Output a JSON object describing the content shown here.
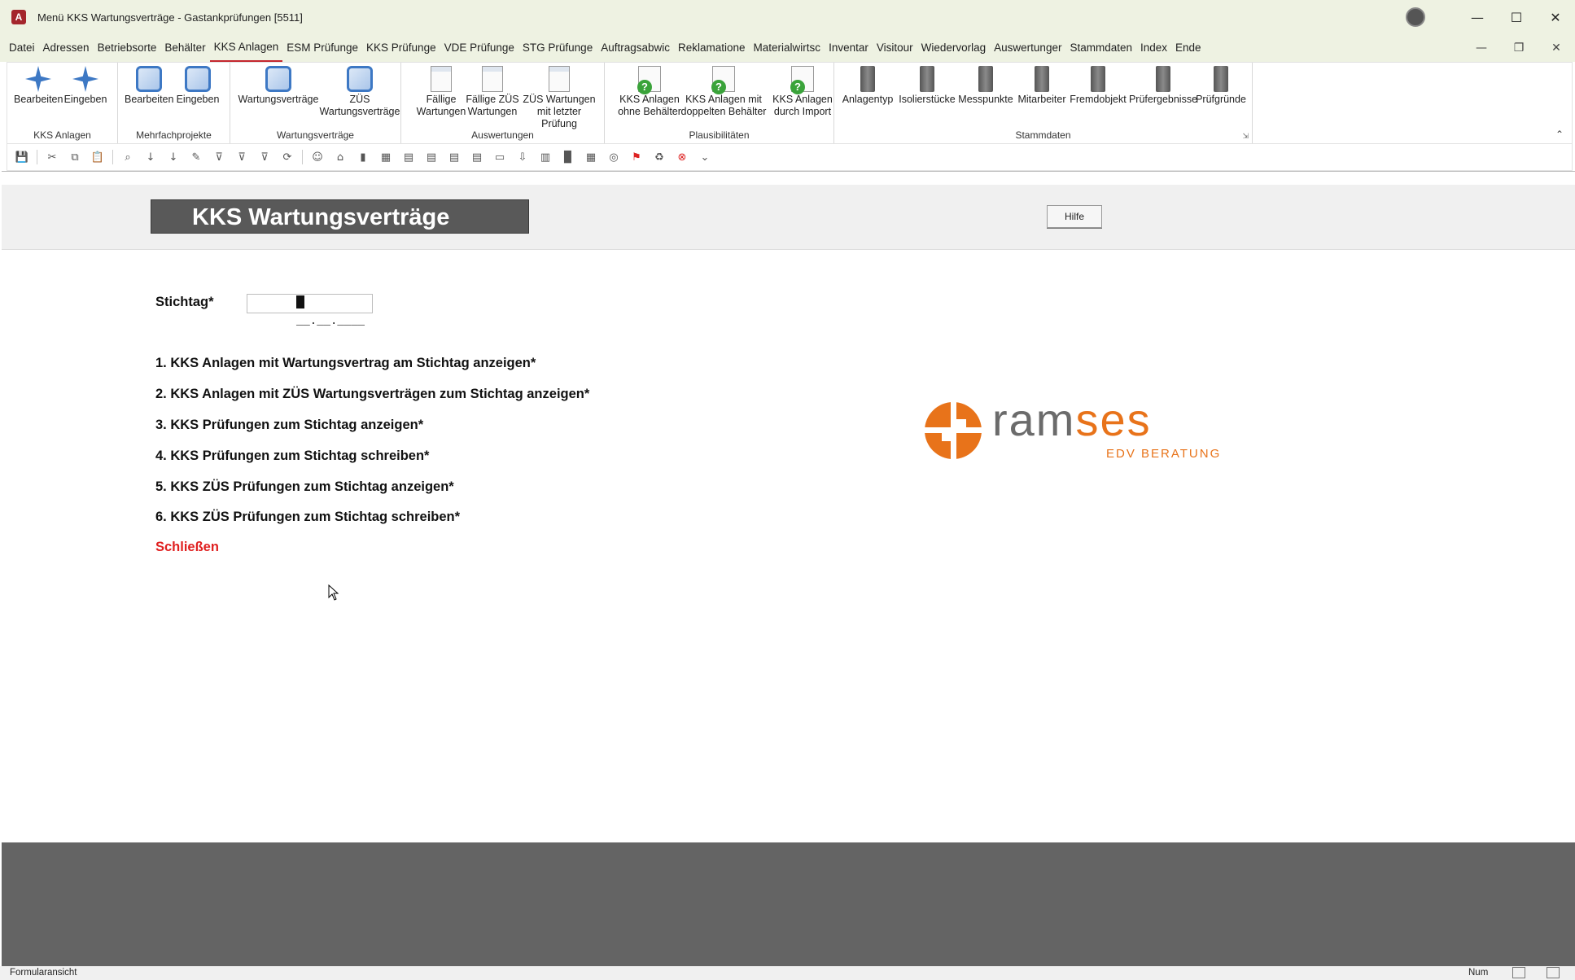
{
  "window": {
    "app_icon": "A",
    "title": "Menü KKS Wartungsverträge  -  Gastankprüfungen [5511]",
    "controls": {
      "minimize": "—",
      "maximize": "☐",
      "close": "✕"
    },
    "mdi_controls": {
      "minimize": "—",
      "restore": "❐",
      "close": "✕"
    }
  },
  "menu": {
    "items": [
      "Datei",
      "Adressen",
      "Betriebsorte",
      "Behälter",
      "KKS Anlagen",
      "ESM Prüfunge",
      "KKS Prüfunge",
      "VDE Prüfunge",
      "STG Prüfunge",
      "Auftragsabwic",
      "Reklamatione",
      "Materialwirtsc",
      "Inventar",
      "Visitour",
      "Wiedervorlag",
      "Auswertunger",
      "Stammdaten",
      "Index",
      "Ende"
    ],
    "active_index": 4
  },
  "ribbon": {
    "groups": [
      {
        "label": "KKS Anlagen",
        "buttons": [
          {
            "label": "Bearbeiten",
            "icon": "blue-star-icon"
          },
          {
            "label": "Eingeben",
            "icon": "blue-star-add-icon"
          }
        ]
      },
      {
        "label": "Mehrfachprojekte",
        "buttons": [
          {
            "label": "Bearbeiten",
            "icon": "network-icon"
          },
          {
            "label": "Eingeben",
            "icon": "network-add-icon"
          }
        ]
      },
      {
        "label": "Wartungsverträge",
        "buttons": [
          {
            "label": "Wartungsverträge",
            "icon": "network-icon"
          },
          {
            "label": "ZÜS\nWartungsverträge",
            "icon": "network-icon"
          }
        ]
      },
      {
        "label": "Auswertungen",
        "buttons": [
          {
            "label": "Fällige\nWartungen",
            "icon": "report-icon"
          },
          {
            "label": "Fällige ZÜS\nWartungen",
            "icon": "report-icon"
          },
          {
            "label": "ZÜS Wartungen\nmit letzter Prüfung",
            "icon": "report-icon"
          }
        ]
      },
      {
        "label": "Plausibilitäten",
        "buttons": [
          {
            "label": "KKS Anlagen\nohne Behälter",
            "icon": "check-question-icon"
          },
          {
            "label": "KKS Anlagen mit\ndoppelten Behälter",
            "icon": "check-question-icon"
          },
          {
            "label": "KKS Anlagen\ndurch Import",
            "icon": "check-question-icon"
          }
        ]
      },
      {
        "label": "Stammdaten",
        "buttons": [
          {
            "label": "Anlagentyp",
            "icon": "binder-icon"
          },
          {
            "label": "Isolierstücke",
            "icon": "binder-icon"
          },
          {
            "label": "Messpunkte",
            "icon": "binder-icon"
          },
          {
            "label": "Mitarbeiter",
            "icon": "binder-icon"
          },
          {
            "label": "Fremdobjekt",
            "icon": "binder-icon"
          },
          {
            "label": "Prüfergebnisse",
            "icon": "binder-icon"
          },
          {
            "label": "Prüfgründe",
            "icon": "binder-icon"
          }
        ]
      }
    ],
    "collapse_glyph": "⌃",
    "launcher_glyph": "⇲"
  },
  "qat": {
    "icons": [
      "save-icon",
      "cut-icon",
      "copy-icon",
      "paste-icon",
      "find-icon",
      "sort-asc-icon",
      "sort-desc-icon",
      "spell-icon",
      "filter-selection-icon",
      "filter-icon",
      "clear-filter-icon",
      "refresh-icon",
      "people-icon",
      "home-icon",
      "delete-icon",
      "table-icon",
      "form-icon",
      "form2-icon",
      "form3-icon",
      "form4-icon",
      "report-icon",
      "export-icon",
      "datasheet-icon",
      "chart-icon",
      "grid-icon",
      "web-icon",
      "flag-icon",
      "recycle-icon",
      "stop-icon",
      "customize-icon"
    ],
    "glyphs": [
      "💾",
      "✂",
      "⧉",
      "📋",
      "⌕",
      "↓",
      "↓",
      "✎",
      "⊽",
      "⊽",
      "⊽",
      "⟳",
      "☺",
      "⌂",
      "▮",
      "▦",
      "▤",
      "▤",
      "▤",
      "▤",
      "▭",
      "⇩",
      "▥",
      "▉",
      "▦",
      "◎",
      "⚑",
      "♻",
      "⊗",
      "⌄"
    ]
  },
  "form": {
    "title": "KKS Wartungsverträge",
    "help_button": "Hilfe",
    "stichtag_label": "Stichtag*",
    "stichtag_value": "__.__.____",
    "options": [
      "1. KKS Anlagen mit Wartungsvertrag am Stichtag anzeigen*",
      "2. KKS Anlagen mit ZÜS Wartungsverträgen zum Stichtag anzeigen*",
      "3. KKS Prüfungen zum Stichtag anzeigen*",
      "4. KKS Prüfungen zum Stichtag schreiben*",
      "5. KKS ZÜS Prüfungen zum Stichtag anzeigen*",
      "6. KKS ZÜS Prüfungen zum Stichtag schreiben*"
    ],
    "close_label": "Schließen",
    "logo": {
      "word": "ramses",
      "tagline": "EDV BERATUNG",
      "color": "#e8731a",
      "gray": "#6b6b6b"
    }
  },
  "statusbar": {
    "left": "Formularansicht",
    "num": "Num"
  },
  "colors": {
    "accent": "#c4262e",
    "title_bg": "#595959",
    "close_red": "#e02020",
    "footer_gray": "#646464"
  }
}
